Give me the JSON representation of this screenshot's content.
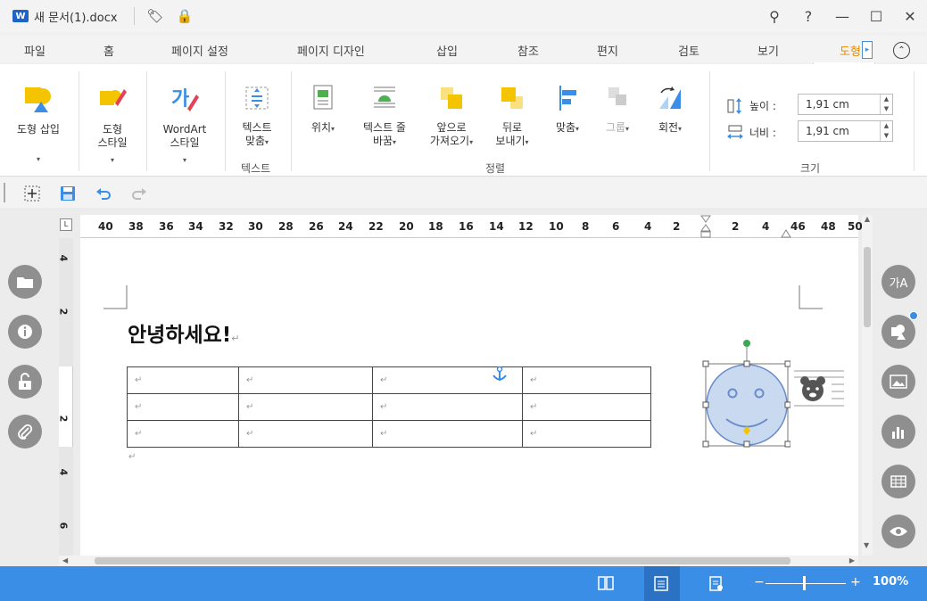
{
  "window": {
    "app_badge": "W",
    "title": "새 문서(1).docx",
    "min_label": "—",
    "max_label": "☐",
    "close_label": "✕",
    "help_label": "?"
  },
  "tabs": [
    {
      "label": "파일"
    },
    {
      "label": "홈"
    },
    {
      "label": "페이지 설정"
    },
    {
      "label": "페이지 디자인"
    },
    {
      "label": "삽입"
    },
    {
      "label": "참조"
    },
    {
      "label": "편지"
    },
    {
      "label": "검토"
    },
    {
      "label": "보기"
    },
    {
      "label": "도형"
    }
  ],
  "ribbon": {
    "insert_shape": "도형 삽입",
    "shape_style_1": "도형",
    "shape_style_2": "스타일",
    "wordart_1": "WordArt",
    "wordart_2": "스타일",
    "text_fit_1": "텍스트",
    "text_fit_2": "맞춤",
    "text_group": "텍스트",
    "position": "위치",
    "text_wrap_1": "텍스트 줄",
    "text_wrap_2": "바꿈",
    "bring_forward_1": "앞으로",
    "bring_forward_2": "가져오기",
    "send_backward_1": "뒤로",
    "send_backward_2": "보내기",
    "align": "맞춤",
    "group": "그룹",
    "rotate": "회전",
    "arrange_group": "정렬",
    "height_label": "높이 :",
    "height_value": "1,91 cm",
    "width_label": "너비 :",
    "width_value": "1,91 cm",
    "size_group": "크기"
  },
  "ruler": {
    "h_ticks": [
      "40",
      "38",
      "36",
      "34",
      "32",
      "30",
      "28",
      "26",
      "24",
      "22",
      "20",
      "18",
      "16",
      "14",
      "12",
      "10",
      "8",
      "6",
      "4",
      "2",
      "2",
      "4",
      "46",
      "48",
      "50"
    ],
    "v_ticks": [
      "4",
      "2",
      "2",
      "4",
      "6"
    ]
  },
  "document": {
    "heading": "안녕하세요!",
    "para_mark": "↵",
    "table_rows": 3,
    "table_cols": 4
  },
  "side_left": [
    "folder-icon",
    "info-icon",
    "lock-icon",
    "attach-icon"
  ],
  "side_right": [
    "text-style-icon",
    "shape-icon",
    "image-icon",
    "chart-icon",
    "table-icon",
    "view-icon"
  ],
  "status": {
    "zoom_minus": "−",
    "zoom_plus": "+",
    "zoom_value": "100%"
  },
  "colors": {
    "accent": "#3a8ee6",
    "tab_active": "#e48a00",
    "shape_yellow": "#f5c400"
  }
}
